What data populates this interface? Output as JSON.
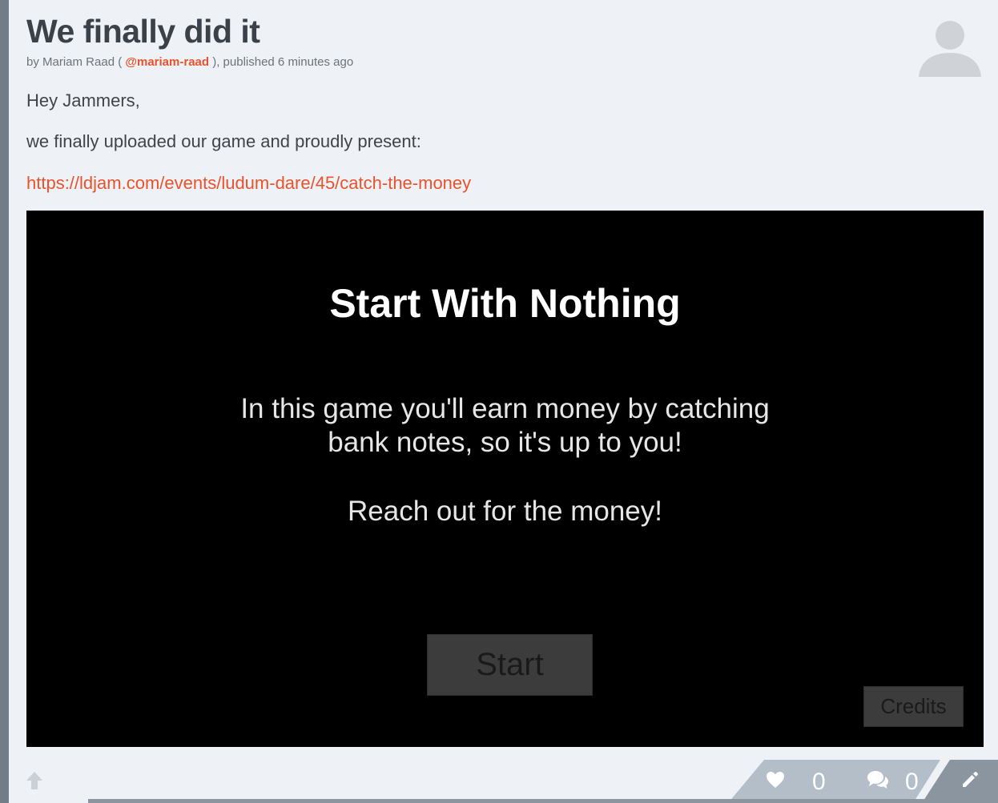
{
  "post": {
    "title": "We finally did it",
    "byline_prefix": "by Mariam Raad ( ",
    "handle": "@mariam-raad",
    "byline_suffix": " ), published 6 minutes ago",
    "paragraphs": [
      "Hey Jammers,",
      "we finally uploaded our game and proudly present:"
    ],
    "link_text": "https://ldjam.com/events/ludum-dare/45/catch-the-money"
  },
  "game": {
    "title": "Start With Nothing",
    "description_lines": [
      "In this game you'll earn money by catching",
      "bank notes, so it's up to you!",
      "Reach out for the money!"
    ],
    "start_label": "Start",
    "credits_label": "Credits"
  },
  "footer": {
    "love_count": "0",
    "comment_count": "0"
  },
  "icons": {
    "avatar": "user-silhouette-icon",
    "up": "arrow-up-icon",
    "love": "heart-icon",
    "comment": "comment-bubbles-icon",
    "edit": "pencil-icon"
  },
  "colors": {
    "accent": "#e8532d",
    "page": "#eef1f5",
    "text": "#3f454b",
    "rail": "#737d87",
    "footer_bar": "#b4bec8",
    "footer_bar_dark": "#8b95a0"
  }
}
